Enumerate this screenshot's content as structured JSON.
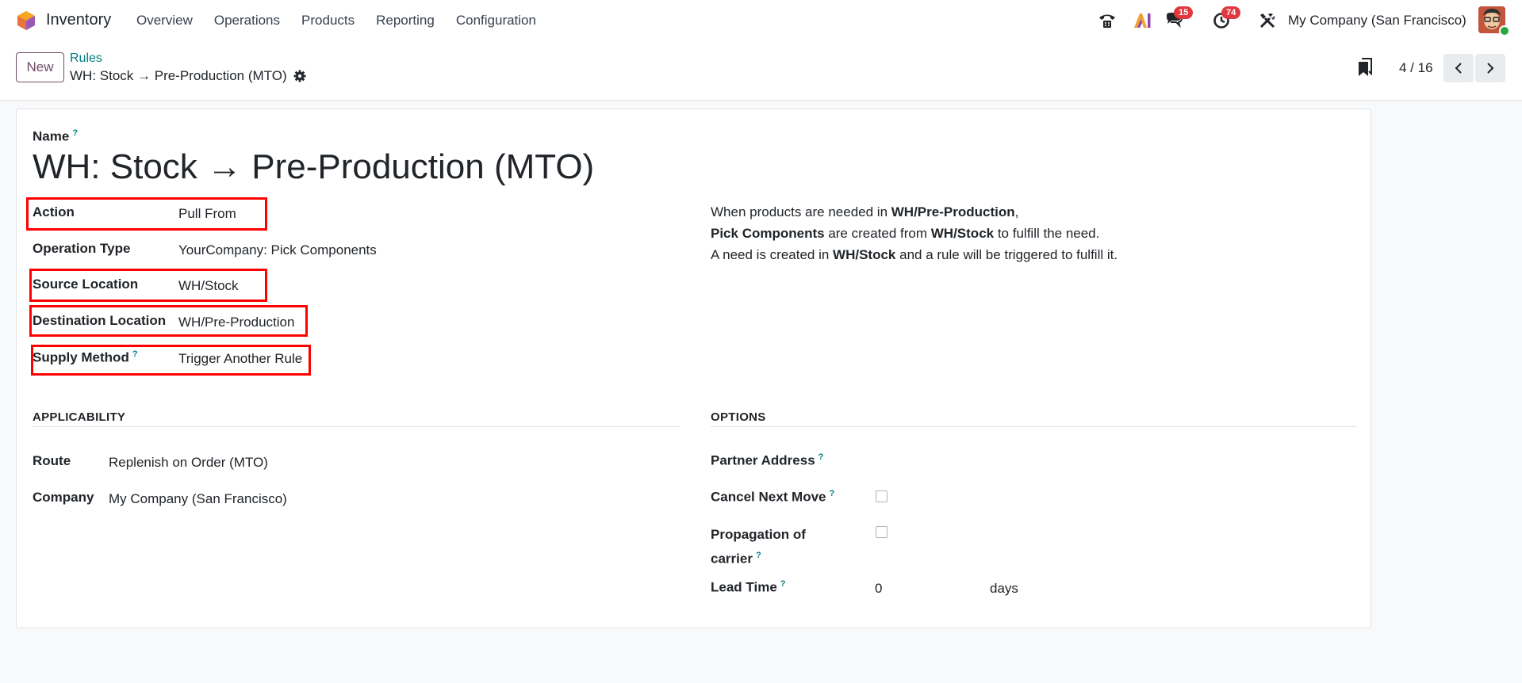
{
  "navbar": {
    "app_name": "Inventory",
    "menu": [
      "Overview",
      "Operations",
      "Products",
      "Reporting",
      "Configuration"
    ],
    "messages_badge": "15",
    "activities_badge": "74",
    "company": "My Company (San Francisco)"
  },
  "control_panel": {
    "new_label": "New",
    "breadcrumb_parent": "Rules",
    "breadcrumb_current": "WH: Stock → Pre-Production (MTO)",
    "pager": "4 / 16"
  },
  "form": {
    "name_label": "Name",
    "name_value": "WH: Stock → Pre-Production (MTO)",
    "fields": {
      "action": {
        "label": "Action",
        "value": "Pull From"
      },
      "operation_type": {
        "label": "Operation Type",
        "value": "YourCompany: Pick Components"
      },
      "source_location": {
        "label": "Source Location",
        "value": "WH/Stock"
      },
      "destination_location": {
        "label": "Destination Location",
        "value": "WH/Pre-Production"
      },
      "supply_method": {
        "label": "Supply Method",
        "value": "Trigger Another Rule"
      }
    },
    "description": {
      "line1_pre": "When products are needed in ",
      "line1_bold": "WH/Pre-Production",
      "line1_post": ",",
      "line2_bold1": "Pick Components",
      "line2_mid": " are created from ",
      "line2_bold2": "WH/Stock",
      "line2_post": " to fulfill the need.",
      "line3_pre": "A need is created in ",
      "line3_bold": "WH/Stock",
      "line3_post": " and a rule will be triggered to fulfill it."
    },
    "applicability": {
      "title": "APPLICABILITY",
      "route_label": "Route",
      "route_value": "Replenish on Order (MTO)",
      "company_label": "Company",
      "company_value": "My Company (San Francisco)"
    },
    "options": {
      "title": "OPTIONS",
      "partner_address_label": "Partner Address",
      "cancel_next_move_label": "Cancel Next Move",
      "propagation_label_1": "Propagation of",
      "propagation_label_2": "carrier",
      "lead_time_label": "Lead Time",
      "lead_time_value": "0",
      "lead_time_unit": "days"
    },
    "help_mark": "?"
  },
  "colors": {
    "brand": "#714b67",
    "link": "#017e84",
    "highlight": "#ff0000",
    "badge": "#e0383e"
  }
}
